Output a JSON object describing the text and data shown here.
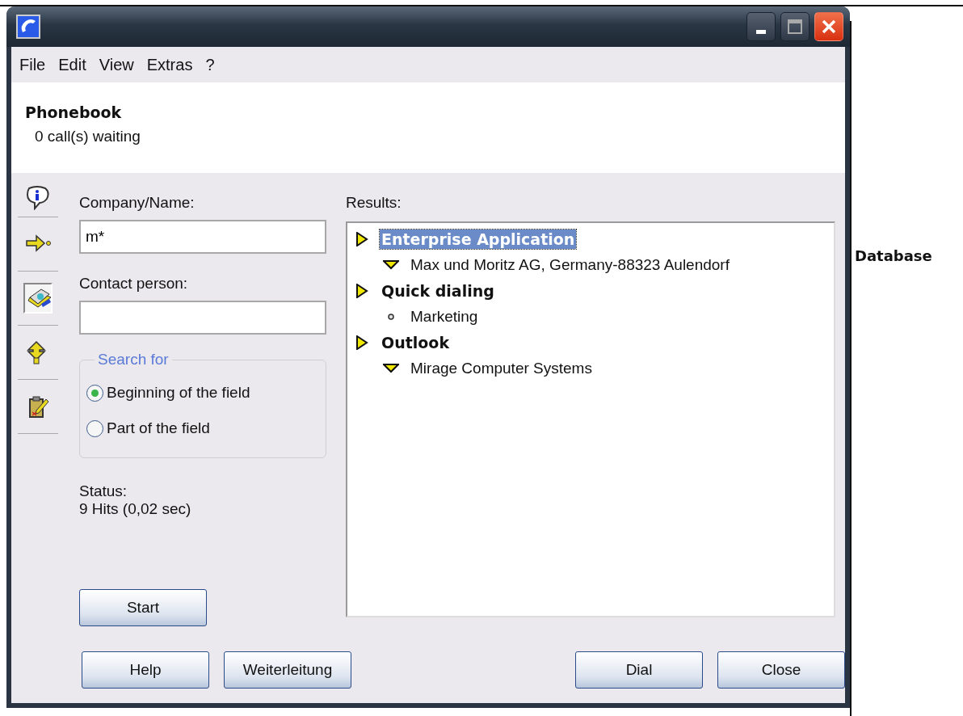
{
  "menu": [
    "File",
    "Edit",
    "View",
    "Extras",
    "?"
  ],
  "header": {
    "title": "Phonebook",
    "subtitle": "0 call(s) waiting"
  },
  "toolbar": [
    {
      "kind": "info",
      "selected": false
    },
    {
      "kind": "arrow",
      "selected": false
    },
    {
      "kind": "printer",
      "selected": true
    },
    {
      "kind": "double-arrow",
      "selected": false
    },
    {
      "kind": "clipboard",
      "selected": false
    }
  ],
  "form": {
    "company_label": "Company/Name:",
    "company_value": "m*",
    "contact_label": "Contact person:",
    "search_for": {
      "title": "Search for",
      "options": [
        {
          "label": "Beginning of the field",
          "selected": true
        },
        {
          "label": "Part of the field",
          "selected": false
        }
      ]
    },
    "status_label": "Status:",
    "status_value": "9 Hits (0,02 sec)",
    "start_button": "Start"
  },
  "results": {
    "label": "Results:",
    "groups": [
      {
        "label": "Enterprise Application",
        "selected": true,
        "children": [
          {
            "label": "Max und Moritz AG, Germany-88323 Aulendorf",
            "kind": "contact"
          }
        ]
      },
      {
        "label": "Quick dialing",
        "selected": false,
        "children": [
          {
            "label": "Marketing",
            "kind": "entry"
          }
        ]
      },
      {
        "label": "Outlook",
        "selected": false,
        "children": [
          {
            "label": "Mirage Computer Systems",
            "kind": "contact"
          }
        ]
      }
    ]
  },
  "buttons": {
    "left": [
      "Help",
      "Weiterleitung"
    ],
    "right": [
      "Dial",
      "Close"
    ]
  },
  "side_label": "Database"
}
